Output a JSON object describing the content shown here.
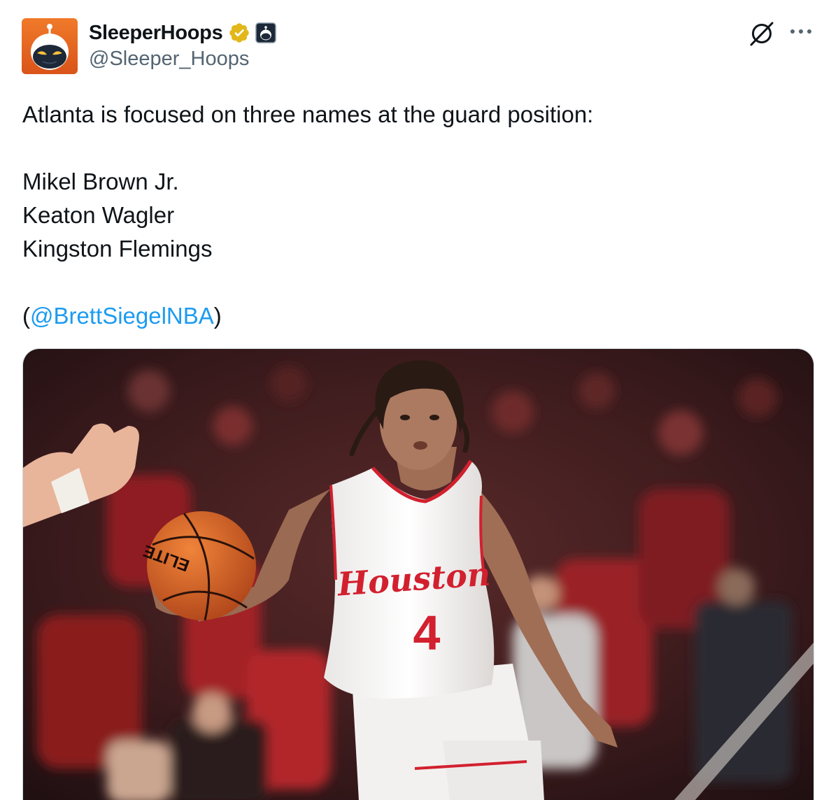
{
  "author": {
    "display_name": "SleeperHoops",
    "handle": "@Sleeper_Hoops",
    "verified_badge": "gold-verified-badge-icon",
    "affiliate_badge": "sleeper-affiliate-badge-icon"
  },
  "actions": {
    "grok_icon": "grok-icon",
    "more_icon": "more-options-icon"
  },
  "tweet": {
    "line1": "Atlanta is focused on three names at the guard position:",
    "name1": "Mikel Brown Jr.",
    "name2": "Keaton Wagler",
    "name3": "Kingston Flemings",
    "paren_open": "(",
    "mention": "@BrettSiegelNBA",
    "paren_close": ")"
  },
  "media": {
    "jersey_text": "Houston",
    "jersey_number": "4",
    "ball_text": "ELITE"
  },
  "colors": {
    "accent_blue": "#1d9bf0",
    "avatar_orange": "#e8651a",
    "jersey_red": "#d2202f",
    "verified_gold": "#e2b719"
  }
}
